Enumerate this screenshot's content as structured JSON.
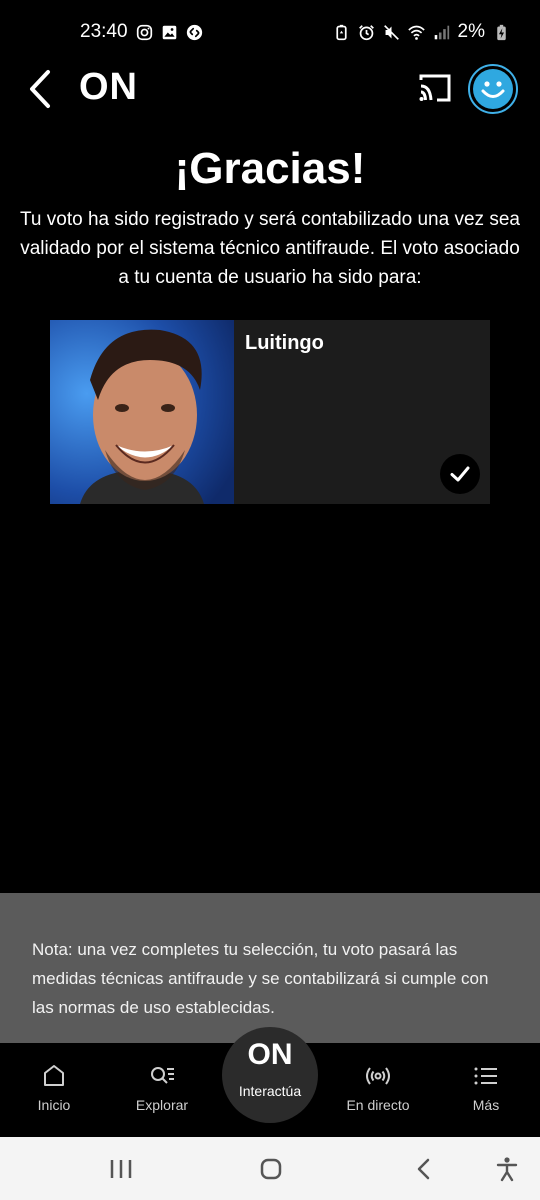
{
  "status_bar": {
    "time": "23:40",
    "battery": "2%",
    "left_icons": [
      "instagram-icon",
      "gallery-icon",
      "shazam-icon"
    ],
    "right_icons": [
      "battery-saver-icon",
      "alarm-icon",
      "mute-icon",
      "wifi-icon",
      "signal-icon",
      "battery-charging-icon"
    ]
  },
  "header": {
    "app_name": "ON",
    "back_icon": "chevron-left-icon",
    "cast_icon": "cast-icon",
    "avatar_icon": "smiley-avatar-icon"
  },
  "main": {
    "title": "¡Gracias!",
    "message": "Tu voto ha sido registrado y será contabilizado una vez sea validado por el sistema técnico antifraude. El voto asociado a tu cuenta de usuario ha sido para:",
    "candidate": {
      "name": "Luitingo",
      "selected": true
    }
  },
  "note": {
    "text": "Nota: una vez completes tu selección, tu voto pasará las medidas técnicas antifraude y se contabilizará si cumple con las normas de uso establecidas."
  },
  "bottom_nav": {
    "items": [
      {
        "label": "Inicio",
        "icon": "home-icon"
      },
      {
        "label": "Explorar",
        "icon": "search-list-icon"
      },
      {
        "label": "Interactúa",
        "icon": "on-logo-icon",
        "logo_text": "ON",
        "active": true
      },
      {
        "label": "En directo",
        "icon": "broadcast-icon"
      },
      {
        "label": "Más",
        "icon": "menu-icon"
      }
    ]
  },
  "system_nav": {
    "icons": [
      "recent-apps-icon",
      "home-button-icon",
      "back-icon",
      "accessibility-icon"
    ]
  },
  "colors": {
    "background": "#000000",
    "card": "#1c1c1c",
    "note_panel": "#5b5b5b",
    "accent_avatar": "#2fa8e0"
  }
}
